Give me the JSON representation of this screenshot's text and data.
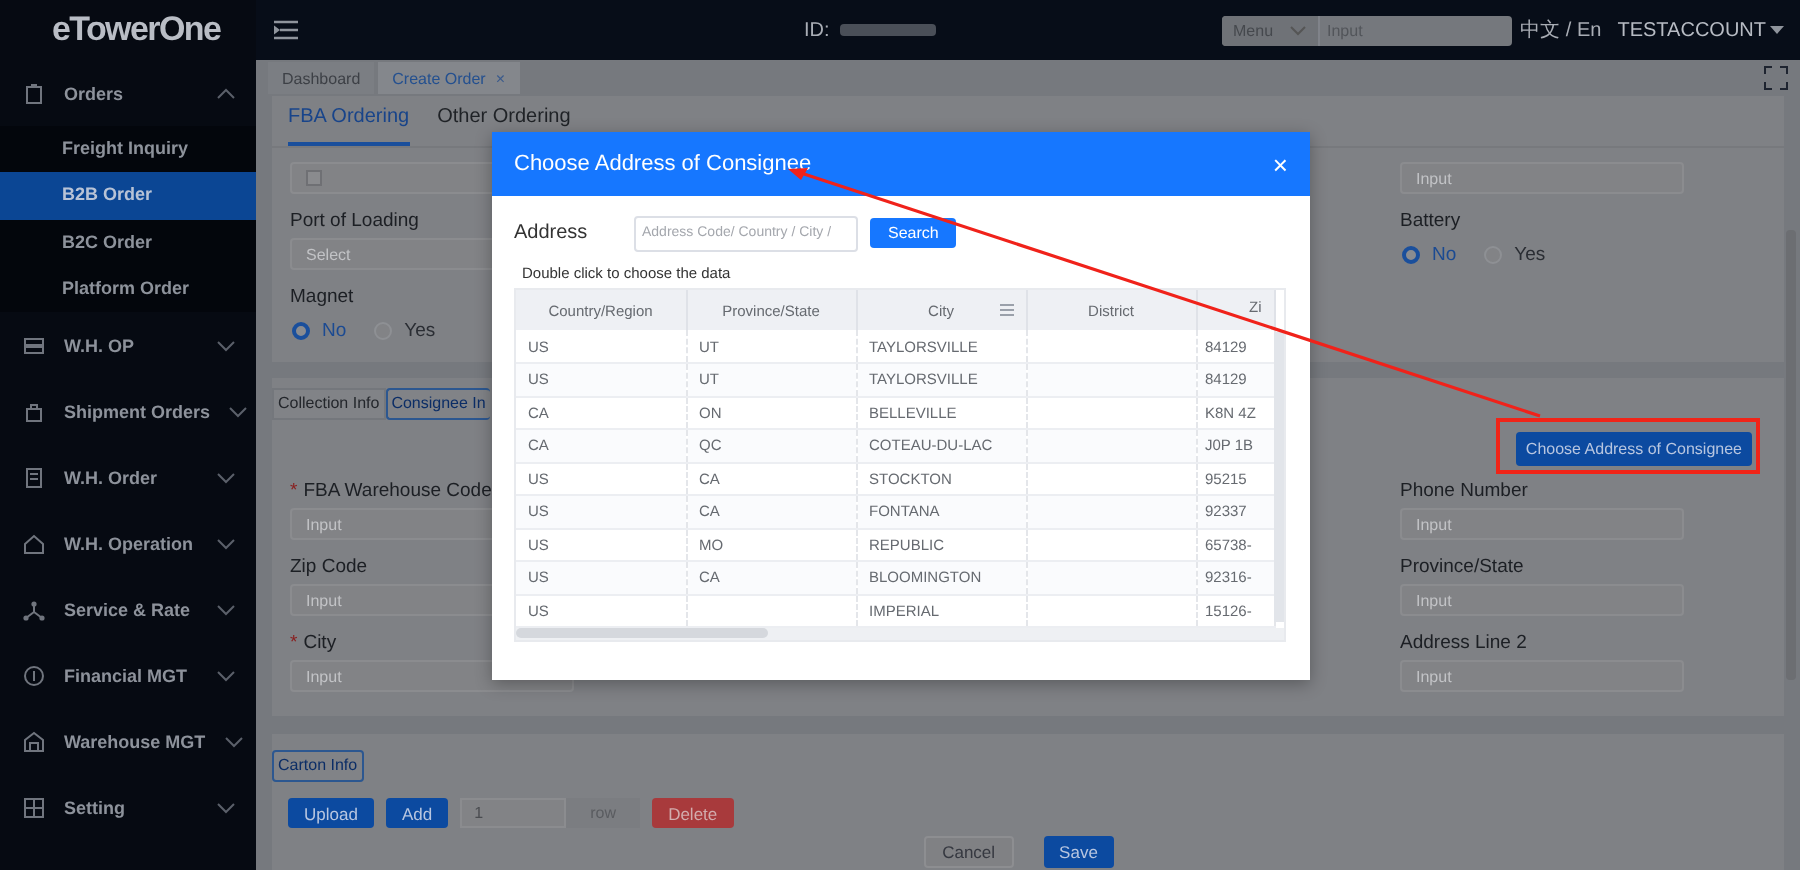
{
  "app": {
    "logo": "eTowerOne"
  },
  "topbar": {
    "id_label": "ID:",
    "search": {
      "scope": "Menu",
      "placeholder": "Input"
    },
    "language": "中文 / En",
    "account": "TESTACCOUNT"
  },
  "sidebar": {
    "items": [
      {
        "label": "Orders",
        "expanded": true,
        "children": [
          {
            "label": "Freight Inquiry",
            "selected": false
          },
          {
            "label": "B2B Order",
            "selected": true
          },
          {
            "label": "B2C Order",
            "selected": false
          },
          {
            "label": "Platform Order",
            "selected": false
          }
        ]
      },
      {
        "label": "W.H. OP",
        "expanded": false
      },
      {
        "label": "Shipment Orders",
        "expanded": false
      },
      {
        "label": "W.H. Order",
        "expanded": false
      },
      {
        "label": "W.H. Operation",
        "expanded": false
      },
      {
        "label": "Service & Rate",
        "expanded": false
      },
      {
        "label": "Financial MGT",
        "expanded": false
      },
      {
        "label": "Warehouse MGT",
        "expanded": false
      },
      {
        "label": "Setting",
        "expanded": false
      }
    ]
  },
  "page_tabs": [
    {
      "label": "Dashboard",
      "selected": false
    },
    {
      "label": "Create Order",
      "selected": true,
      "close": "×"
    }
  ],
  "order_tabs": [
    {
      "label": "FBA Ordering",
      "selected": true
    },
    {
      "label": "Other Ordering",
      "selected": false
    }
  ],
  "upper_form": {
    "left": [
      {
        "kind": "icon-input"
      },
      {
        "kind": "select",
        "label": "Port of Loading",
        "placeholder": "Select"
      },
      {
        "kind": "radio",
        "label": "Magnet",
        "options": [
          {
            "label": "No",
            "selected": true
          },
          {
            "label": "Yes",
            "selected": false
          }
        ]
      }
    ],
    "right": [
      {
        "kind": "input",
        "placeholder": "Input"
      },
      {
        "kind": "radio",
        "label": "Battery",
        "options": [
          {
            "label": "No",
            "selected": true
          },
          {
            "label": "Yes",
            "selected": false
          }
        ]
      }
    ]
  },
  "info_tabs": [
    {
      "label": "Collection Info",
      "selected": false
    },
    {
      "label": "Consignee In",
      "selected": true
    }
  ],
  "choose_button": "Choose Address of Consignee",
  "consignee_form": {
    "left": [
      {
        "label": "FBA Warehouse Code",
        "required": "*",
        "placeholder": "Input"
      },
      {
        "label": "Zip Code",
        "placeholder": "Input"
      },
      {
        "label": "City",
        "required": "*",
        "placeholder": "Input"
      }
    ],
    "right": [
      {
        "label": "Phone Number",
        "placeholder": "Input"
      },
      {
        "label": "Province/State",
        "placeholder": "Input"
      },
      {
        "label": "Address Line 2",
        "placeholder": "Input"
      }
    ]
  },
  "carton": {
    "tab": {
      "label": "Carton Info",
      "selected": true
    },
    "upload": "Upload",
    "add": "Add",
    "row_count": "1",
    "row_unit": "row",
    "delete": "Delete"
  },
  "footer_buttons": [
    {
      "label": "Cancel",
      "kind": "default"
    },
    {
      "label": "Save",
      "kind": "primary"
    }
  ],
  "modal": {
    "title": "Choose Address of Consignee",
    "close": "×",
    "search": {
      "label": "Address",
      "placeholder": "Address Code/ Country / City /",
      "button": "Search"
    },
    "hint": "Double click to choose the data",
    "table": {
      "columns": [
        {
          "label": "Country/Region"
        },
        {
          "label": "Province/State"
        },
        {
          "label": "City",
          "menu": true
        },
        {
          "label": "District"
        },
        {
          "label": "Zi"
        }
      ],
      "rows": [
        [
          "US",
          "UT",
          "TAYLORSVILLE",
          "",
          "84129"
        ],
        [
          "US",
          "UT",
          "TAYLORSVILLE",
          "",
          "84129"
        ],
        [
          "CA",
          "ON",
          "BELLEVILLE",
          "",
          "K8N 4Z"
        ],
        [
          "CA",
          "QC",
          "COTEAU-DU-LAC",
          "",
          "J0P 1B"
        ],
        [
          "US",
          "CA",
          "STOCKTON",
          "",
          "95215"
        ],
        [
          "US",
          "CA",
          "FONTANA",
          "",
          "92337"
        ],
        [
          "US",
          "MO",
          "REPUBLIC",
          "",
          "65738-"
        ],
        [
          "US",
          "CA",
          "BLOOMINGTON",
          "",
          "92316-"
        ],
        [
          "US",
          "",
          "IMPERIAL",
          "",
          "15126-"
        ]
      ]
    }
  }
}
